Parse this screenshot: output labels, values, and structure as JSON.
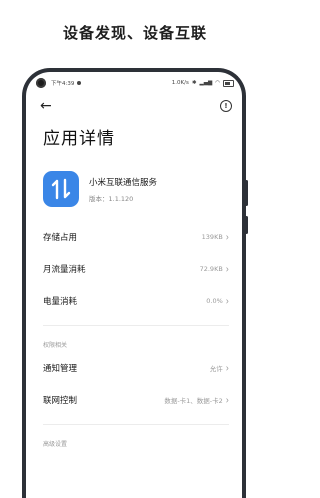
{
  "caption": "设备发现、设备互联",
  "status_bar": {
    "time": "下午4:39",
    "right_text": "1.0K/s"
  },
  "page": {
    "title": "应用详情"
  },
  "app": {
    "name": "小米互联通信服务",
    "version": "版本：1.1.120",
    "icon_color": "#3a86e7"
  },
  "rows": [
    {
      "label": "存储占用",
      "value": "139KB"
    },
    {
      "label": "月流量消耗",
      "value": "72.9KB"
    },
    {
      "label": "电量消耗",
      "value": "0.0%"
    }
  ],
  "permissions_section": {
    "title": "权限相关",
    "rows": [
      {
        "label": "通知管理",
        "value": "允许"
      },
      {
        "label": "联网控制",
        "value": "数据-卡1、数据-卡2"
      }
    ]
  },
  "next_section_title": "高级设置"
}
